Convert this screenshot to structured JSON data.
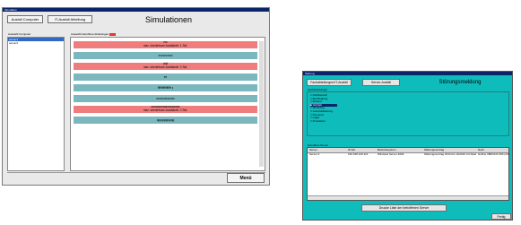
{
  "window1": {
    "title": "Simulation",
    "buttons": {
      "ausfall_computer": "Ausfall Computer",
      "it_ausfall": "IT-Ausfall Abteilung"
    },
    "heading": "Simulationen",
    "list_label": "Auswahl Computer",
    "list_items": [
      "server1",
      "server2"
    ],
    "panel_label": "Auswahl betroffene Abteilungen",
    "rows": [
      {
        "style": "red",
        "line1": "xxx",
        "line2": "max. tolerierbare Ausfallzeit: 1 Std."
      },
      {
        "style": "teal",
        "line1": "xxxxxxxxxx",
        "line2": ""
      },
      {
        "style": "red",
        "line1": "ddd",
        "line2": "max. tolerierbare Ausfallzeit: 2 Std."
      },
      {
        "style": "teal",
        "line1": "ee",
        "line2": ""
      },
      {
        "style": "teal",
        "line1": "ffffffffffffffffff s",
        "line2": ""
      },
      {
        "style": "teal",
        "line1": "xxxxxxxxxxxxx",
        "line2": ""
      },
      {
        "style": "red",
        "line1": "aaaaaaaaaaaaaaaaaa",
        "line2": "max. tolerierbare Ausfallzeit: 2 Std."
      },
      {
        "style": "teal",
        "line1": "qqqqqqqqqqq",
        "line2": ""
      }
    ],
    "menu_button": "Menü"
  },
  "window2": {
    "title": "Störung",
    "buttons": {
      "fachabteilungen": "Fachabteilungen/IT-Ausfall",
      "server": "Server-Ausfall"
    },
    "heading": "Störungsmeldung",
    "group_label": "Fachabteilungen",
    "checkboxes": [
      "Fachbereich",
      "Buchhaltung",
      "Einkauf",
      "Vertrieb",
      "Marketing",
      "Geschäftsleitung",
      "Personal",
      "Lager",
      "Produktion"
    ],
    "selected_index": 3,
    "servers_label": "betroffene Server",
    "table_headers": [
      "Server",
      "IP Adr.",
      "Betriebssystem",
      "Wartungsvertrag",
      "Notiz"
    ],
    "table_row": [
      "Server 2",
      "192.168.120.121",
      "Windows Server 2003",
      "Wartungsvertrag 2014 bis 12/2016 mit Reaktionszeit 4h",
      "Hotline 0800/123 456 (24h erreichbar)"
    ],
    "show_list_button": "Drucke Liste der betroffenen Server",
    "done_button": "Fertig"
  }
}
